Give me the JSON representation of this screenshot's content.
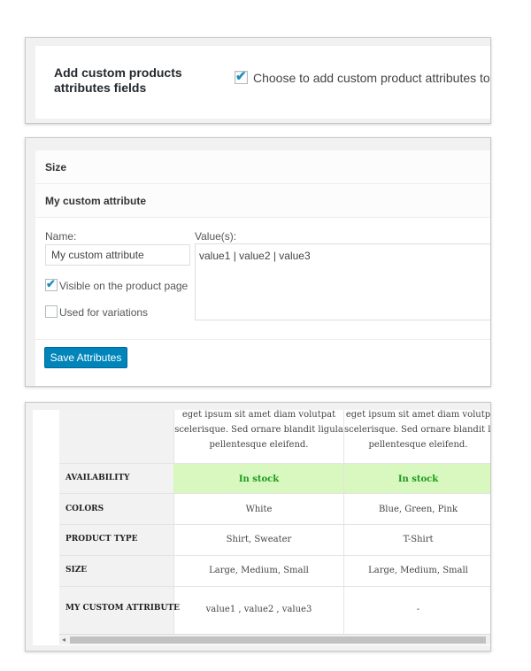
{
  "settings": {
    "title": "Add custom products attributes fields",
    "checkbox_checked": true,
    "checkbox_label": "Choose to add custom product attributes to c"
  },
  "attributes_editor": {
    "rows": [
      "Size",
      "My custom attribute"
    ],
    "name_label": "Name:",
    "name_value": "My custom attribute",
    "values_label": "Value(s):",
    "values_value": "value1 | value2 | value3",
    "visible_label": "Visible on the product page",
    "visible_checked": true,
    "variations_label": "Used for variations",
    "variations_checked": false,
    "save_label": "Save Attributes"
  },
  "compare_table": {
    "description_lines": [
      "eget ipsum sit amet diam volutpat",
      "scelerisque. Sed ornare blandit ligula",
      "pellentesque eleifend."
    ],
    "description_lines_col2": [
      "eget ipsum sit amet diam volutp",
      "scelerisque. Sed ornare blandit li",
      "pellentesque eleifend."
    ],
    "rows": [
      {
        "label": "AVAILABILITY",
        "values": [
          "In stock",
          "In stock"
        ]
      },
      {
        "label": "COLORS",
        "values": [
          "White",
          "Blue, Green, Pink"
        ]
      },
      {
        "label": "PRODUCT TYPE",
        "values": [
          "Shirt, Sweater",
          "T-Shirt"
        ]
      },
      {
        "label": "SIZE",
        "values": [
          "Large, Medium, Small",
          "Large, Medium, Small"
        ]
      },
      {
        "label": "MY CUSTOM ATTRIBUTE",
        "values": [
          "value1 , value2 , value3",
          "-"
        ]
      }
    ],
    "scroll_arrow": "◂"
  },
  "colors": {
    "accent": "#0085ba",
    "in_stock_bg": "#d8f8c0",
    "in_stock_text": "#1a9b1a"
  }
}
